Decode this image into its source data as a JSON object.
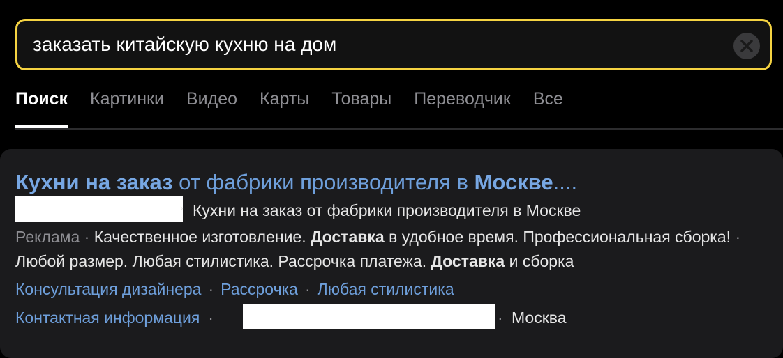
{
  "search": {
    "query": "заказать китайскую кухню на дом",
    "clear_icon": "close-icon"
  },
  "tabs": [
    {
      "label": "Поиск",
      "active": true
    },
    {
      "label": "Картинки",
      "active": false
    },
    {
      "label": "Видео",
      "active": false
    },
    {
      "label": "Карты",
      "active": false
    },
    {
      "label": "Товары",
      "active": false
    },
    {
      "label": "Переводчик",
      "active": false
    },
    {
      "label": "Все",
      "active": false
    }
  ],
  "ad": {
    "title_bold_1": "Кухни на заказ",
    "title_mid": " от фабрики производителя в ",
    "title_bold_2": "Москве",
    "title_ellipsis": "....",
    "url_arrow": "›",
    "url_text": "Кухни на заказ от фабрики производителя в Москве",
    "ad_label": "Реклама",
    "sep": " · ",
    "desc_1": "Качественное изготовление. ",
    "desc_bold_1": "Доставка",
    "desc_2": " в удобное время. Профессиональная сборка!",
    "desc_3": "Любой размер. Любая стилистика. Рассрочка платежа. ",
    "desc_bold_2": "Доставка",
    "desc_4": " и сборка",
    "sitelinks": [
      "Консультация дизайнера",
      "Рассрочка",
      "Любая стилистика"
    ],
    "sitelink_sep": "·",
    "contacts_label": "Контактная информация",
    "contacts_sep": "·",
    "city": "Москва"
  },
  "colors": {
    "accent_border": "#f5d342",
    "link": "#6e9fdb",
    "background": "#000000",
    "card": "#1b1b1d"
  }
}
